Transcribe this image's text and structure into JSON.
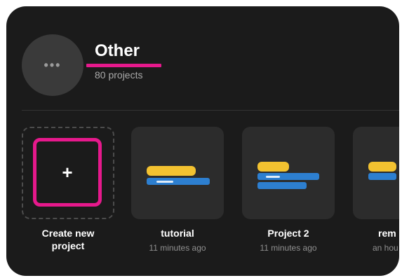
{
  "header": {
    "avatar_label": "•••",
    "title": "Other",
    "subtitle": "80 projects"
  },
  "cards": [
    {
      "label_line1": "Create new",
      "label_line2": "project",
      "icon": "+"
    },
    {
      "label": "tutorial",
      "time": "11 minutes ago"
    },
    {
      "label": "Project 2",
      "time": "11 minutes ago"
    },
    {
      "label": "rem",
      "time": "an hou"
    }
  ],
  "colors": {
    "background": "#1b1b1b",
    "card": "#2c2c2c",
    "highlight": "#e6198c",
    "text_primary": "#ffffff",
    "text_secondary": "#a9a9a9"
  }
}
